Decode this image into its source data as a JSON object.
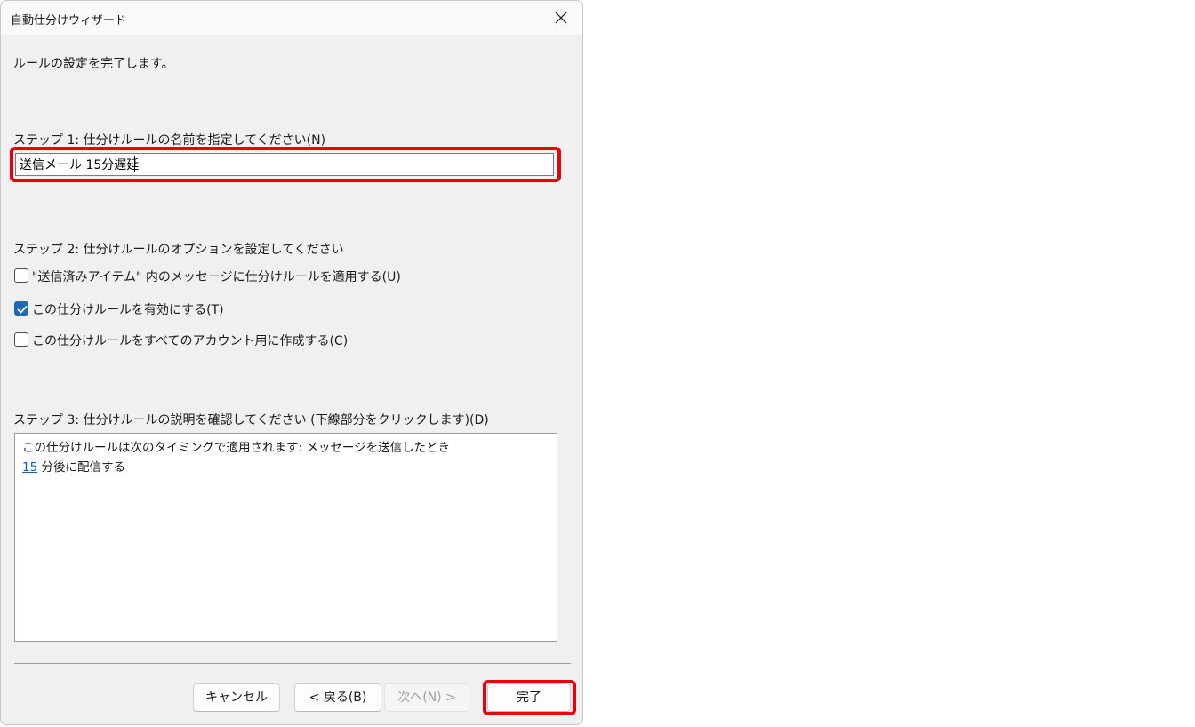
{
  "window": {
    "title": "自動仕分けウィザード",
    "close_icon": "close-icon"
  },
  "intro": "ルールの設定を完了します。",
  "step1": {
    "label": "ステップ 1: 仕分けルールの名前を指定してください(N)",
    "value": "送信メール 15分遅延"
  },
  "step2": {
    "label": "ステップ 2: 仕分けルールのオプションを設定してください",
    "options": [
      {
        "label": "\"送信済みアイテム\" 内のメッセージに仕分けルールを適用する(U)",
        "checked": false
      },
      {
        "label": "この仕分けルールを有効にする(T)",
        "checked": true
      },
      {
        "label": "この仕分けルールをすべてのアカウント用に作成する(C)",
        "checked": false
      }
    ]
  },
  "step3": {
    "label": "ステップ 3: 仕分けルールの説明を確認してください (下線部分をクリックします)(D)",
    "line1": "この仕分けルールは次のタイミングで適用されます: メッセージを送信したとき",
    "link": "15",
    "line2_rest": " 分後に配信する"
  },
  "buttons": {
    "cancel": "キャンセル",
    "back": "< 戻る(B)",
    "next": "次へ(N) >",
    "finish": "完了"
  },
  "colors": {
    "highlight": "#e8000b",
    "checkbox_checked": "#1f6ab5",
    "link": "#1a5fb4"
  }
}
